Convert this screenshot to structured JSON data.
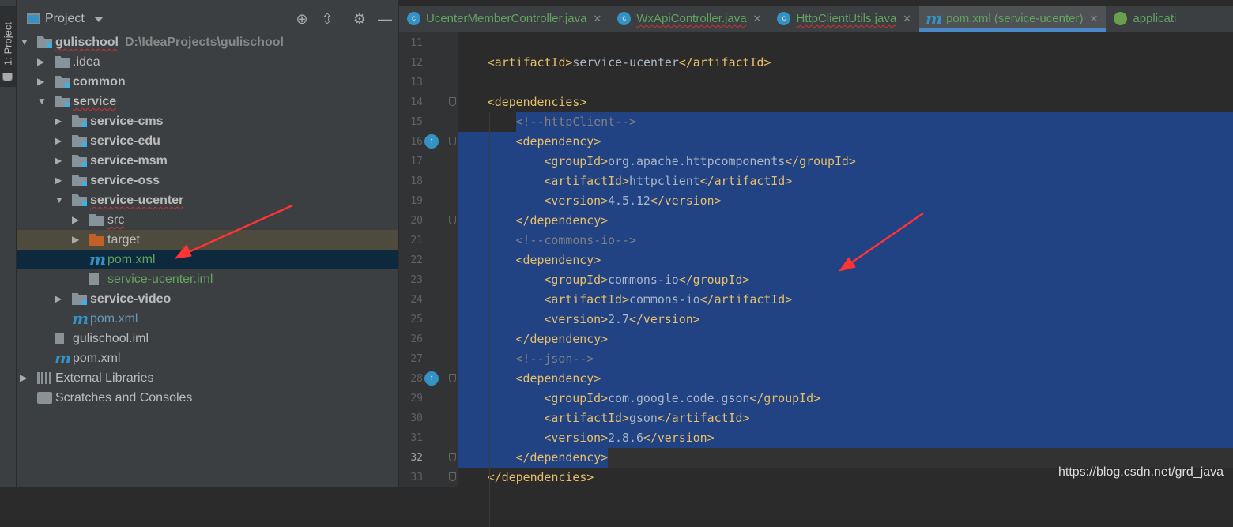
{
  "side_strip": {
    "tab_label": "1: Project"
  },
  "project_panel": {
    "title": "Project",
    "tree": [
      {
        "label": "gulischool",
        "path": "D:\\IdeaProjects\\gulischool",
        "depth": 0,
        "arrow": "down",
        "icon": "module-folder",
        "bold": true,
        "wavy": true
      },
      {
        "label": ".idea",
        "depth": 1,
        "arrow": "right",
        "icon": "folder"
      },
      {
        "label": "common",
        "depth": 1,
        "arrow": "right",
        "icon": "module-folder",
        "bold": true
      },
      {
        "label": "service",
        "depth": 1,
        "arrow": "down",
        "icon": "module-folder",
        "bold": true,
        "wavy": true
      },
      {
        "label": "service-cms",
        "depth": 2,
        "arrow": "right",
        "icon": "module-folder",
        "bold": true
      },
      {
        "label": "service-edu",
        "depth": 2,
        "arrow": "right",
        "icon": "module-folder",
        "bold": true
      },
      {
        "label": "service-msm",
        "depth": 2,
        "arrow": "right",
        "icon": "module-folder",
        "bold": true
      },
      {
        "label": "service-oss",
        "depth": 2,
        "arrow": "right",
        "icon": "module-folder",
        "bold": true
      },
      {
        "label": "service-ucenter",
        "depth": 2,
        "arrow": "down",
        "icon": "module-folder",
        "bold": true,
        "wavy": true
      },
      {
        "label": "src",
        "depth": 3,
        "arrow": "right",
        "icon": "folder",
        "wavy": true
      },
      {
        "label": "target",
        "depth": 3,
        "arrow": "right",
        "icon": "excluded-folder",
        "highlight": true
      },
      {
        "label": "pom.xml",
        "depth": 3,
        "icon": "maven",
        "color": "green",
        "selected": true
      },
      {
        "label": "service-ucenter.iml",
        "depth": 3,
        "icon": "iml",
        "color": "green"
      },
      {
        "label": "service-video",
        "depth": 2,
        "arrow": "right",
        "icon": "module-folder",
        "bold": true
      },
      {
        "label": "pom.xml",
        "depth": 2,
        "icon": "maven",
        "color": "blue"
      },
      {
        "label": "gulischool.iml",
        "depth": 1,
        "icon": "iml"
      },
      {
        "label": "pom.xml",
        "depth": 1,
        "icon": "maven"
      },
      {
        "label": "External Libraries",
        "depth": 0,
        "arrow": "right",
        "icon": "libraries"
      },
      {
        "label": "Scratches and Consoles",
        "depth": 0,
        "icon": "scratches"
      }
    ]
  },
  "editor_tabs": [
    {
      "label": "UcenterMemberController.java",
      "icon": "java-class"
    },
    {
      "label": "WxApiController.java",
      "icon": "java-class",
      "wavy": true
    },
    {
      "label": "HttpClientUtils.java",
      "icon": "java-class",
      "wavy": true
    },
    {
      "label": "pom.xml (service-ucenter)",
      "icon": "maven",
      "active": true
    },
    {
      "label": "applicati",
      "icon": "spring-config"
    }
  ],
  "code_lines": [
    {
      "n": 11,
      "indent": 0,
      "text": ""
    },
    {
      "n": 12,
      "indent": 1,
      "tag1": "<artifactId>",
      "text": "service-ucenter",
      "tag2": "</artifactId>"
    },
    {
      "n": 13,
      "indent": 0,
      "text": ""
    },
    {
      "n": 14,
      "indent": 1,
      "tag1": "<dependencies>",
      "fold": true
    },
    {
      "n": 15,
      "indent": 2,
      "comment": "<!--httpClient-->"
    },
    {
      "n": 16,
      "indent": 2,
      "tag1": "<dependency>",
      "fold": true,
      "marker": true
    },
    {
      "n": 17,
      "indent": 3,
      "tag1": "<groupId>",
      "text": "org.apache.httpcomponents",
      "tag2": "</groupId>"
    },
    {
      "n": 18,
      "indent": 3,
      "tag1": "<artifactId>",
      "text": "httpclient",
      "tag2": "</artifactId>"
    },
    {
      "n": 19,
      "indent": 3,
      "tag1": "<version>",
      "text": "4.5.12",
      "tag2": "</version>"
    },
    {
      "n": 20,
      "indent": 2,
      "tag1": "</dependency>",
      "fold": true
    },
    {
      "n": 21,
      "indent": 2,
      "comment": "<!--commons-io-->"
    },
    {
      "n": 22,
      "indent": 2,
      "tag1": "<dependency>"
    },
    {
      "n": 23,
      "indent": 3,
      "tag1": "<groupId>",
      "text": "commons-io",
      "tag2": "</groupId>"
    },
    {
      "n": 24,
      "indent": 3,
      "tag1": "<artifactId>",
      "text": "commons-io",
      "tag2": "</artifactId>"
    },
    {
      "n": 25,
      "indent": 3,
      "tag1": "<version>",
      "text": "2.7",
      "tag2": "</version>"
    },
    {
      "n": 26,
      "indent": 2,
      "tag1": "</dependency>"
    },
    {
      "n": 27,
      "indent": 2,
      "comment": "<!--json-->"
    },
    {
      "n": 28,
      "indent": 2,
      "tag1": "<dependency>",
      "fold": true,
      "marker": true
    },
    {
      "n": 29,
      "indent": 3,
      "tag1": "<groupId>",
      "text": "com.google.code.gson",
      "tag2": "</groupId>"
    },
    {
      "n": 30,
      "indent": 3,
      "tag1": "<artifactId>",
      "text": "gson",
      "tag2": "</artifactId>"
    },
    {
      "n": 31,
      "indent": 3,
      "tag1": "<version>",
      "text": "2.8.6",
      "tag2": "</version>"
    },
    {
      "n": 32,
      "indent": 2,
      "tag1": "</dependency>",
      "fold": true,
      "bulb": true,
      "current": true
    },
    {
      "n": 33,
      "indent": 1,
      "tag1": "</dependencies>",
      "fold": true
    }
  ],
  "selection": {
    "from_line": 15,
    "to_line": 32
  },
  "watermark": "https://blog.csdn.net/grd_java",
  "colors": {
    "selection": "#214283",
    "tag": "#e8bf6a",
    "comment": "#808080",
    "text": "#a9b7c6",
    "arrow": "#ff3333"
  }
}
